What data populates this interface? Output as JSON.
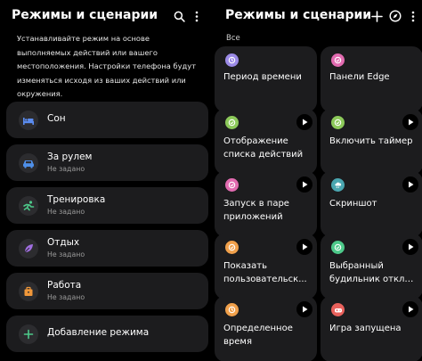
{
  "left": {
    "title": "Режимы и сценарии",
    "description_lines": [
      "Устанавливайте режим на основе",
      "выполняемых действий или вашего",
      "местоположения. Настройки телефона будут",
      "изменяться исходя из ваших действий или",
      "окружения."
    ],
    "modes": [
      {
        "name": "Сон",
        "subtitle": null,
        "icon": "sleep-bed-icon",
        "color": "#5b8cf0"
      },
      {
        "name": "За рулем",
        "subtitle": "Не задано",
        "icon": "car-icon",
        "color": "#4f8fe8"
      },
      {
        "name": "Тренировка",
        "subtitle": "Не задано",
        "icon": "running-person-icon",
        "color": "#4dc98a"
      },
      {
        "name": "Отдых",
        "subtitle": "Не задано",
        "icon": "leaf-icon",
        "color": "#a06ee0"
      },
      {
        "name": "Работа",
        "subtitle": "Не задано",
        "icon": "briefcase-icon",
        "color": "#f0973a"
      }
    ],
    "add_mode_label": "Добавление режима",
    "add_icon_color": "#4dc98a"
  },
  "right": {
    "title": "Режимы и сценарии",
    "section_label": "Все",
    "routines": [
      {
        "lines": [
          "Период времени"
        ],
        "icon": "clock-icon",
        "color": "#9b8ae6",
        "play": false
      },
      {
        "lines": [
          "Панели Edge"
        ],
        "icon": "check-icon",
        "color": "#e26bb0",
        "play": false
      },
      {
        "lines": [
          "Отображение",
          "списка действий"
        ],
        "icon": "check-icon",
        "color": "#8cc95a",
        "play": true
      },
      {
        "lines": [
          "Включить таймер"
        ],
        "icon": "check-icon",
        "color": "#8cc95a",
        "play": true
      },
      {
        "lines": [
          "Запуск в паре",
          "приложений"
        ],
        "icon": "check-icon",
        "color": "#e26bb0",
        "play": true
      },
      {
        "lines": [
          "Скриншот"
        ],
        "icon": "cloud-drop-icon",
        "color": "#4aa6b0",
        "play": true
      },
      {
        "lines": [
          "Показать",
          "пользовательск..."
        ],
        "icon": "check-icon",
        "color": "#f0a04b",
        "play": true
      },
      {
        "lines": [
          "Выбранный",
          "будильник откло..."
        ],
        "icon": "check-icon",
        "color": "#4dc98a",
        "play": true
      },
      {
        "lines": [
          "Определенное",
          "время"
        ],
        "icon": "clock-icon",
        "color": "#f0a04b",
        "play": true
      },
      {
        "lines": [
          "Игра запущена"
        ],
        "icon": "gamepad-icon",
        "color": "#e8615c",
        "play": true
      }
    ]
  },
  "colors": {
    "background": "#000000",
    "card": "#1c1c1e",
    "secondary_text": "#9a9a9a"
  }
}
